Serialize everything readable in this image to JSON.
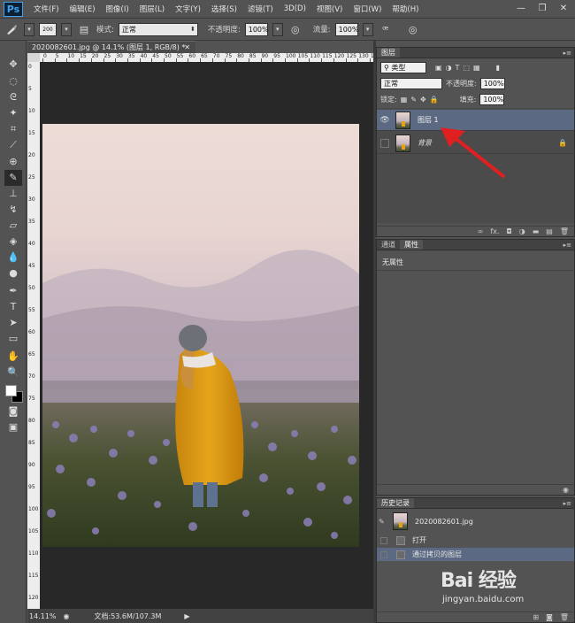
{
  "app": {
    "logo": "Ps"
  },
  "menu": [
    "文件(F)",
    "编辑(E)",
    "图像(I)",
    "图层(L)",
    "文字(Y)",
    "选择(S)",
    "滤镜(T)",
    "3D(D)",
    "视图(V)",
    "窗口(W)",
    "帮助(H)"
  ],
  "window_controls": {
    "minimize": "—",
    "restore": "❐",
    "close": "✕"
  },
  "options": {
    "brush_size": "200",
    "mode_label": "模式:",
    "mode_value": "正常",
    "opacity_label": "不透明度:",
    "opacity_value": "100%",
    "flow_label": "流量:",
    "flow_value": "100%"
  },
  "document": {
    "tab_title": "2020082601.jpg @ 14.1% (图层 1, RGB/8) *",
    "ruler_h": [
      "0",
      "5",
      "10",
      "15",
      "20",
      "25",
      "30",
      "35",
      "40",
      "45",
      "50",
      "55",
      "60",
      "65",
      "70",
      "75",
      "80",
      "85",
      "90",
      "95",
      "100",
      "105",
      "110",
      "115",
      "120",
      "125",
      "130",
      "135"
    ],
    "ruler_v": [
      "0",
      "5",
      "10",
      "15",
      "20",
      "25",
      "30",
      "35",
      "40",
      "45",
      "50",
      "55",
      "60",
      "65",
      "70",
      "75",
      "80",
      "85",
      "90",
      "95",
      "100",
      "105",
      "110",
      "115",
      "120"
    ]
  },
  "status": {
    "zoom": "14.11%",
    "doc_info": "文档:53.6M/107.3M"
  },
  "layers_panel": {
    "tab": "图层",
    "filter_label": "类型",
    "blend_mode": "正常",
    "opacity_label": "不透明度:",
    "opacity_value": "100%",
    "lock_label": "锁定:",
    "fill_label": "填充:",
    "fill_value": "100%",
    "layers": [
      {
        "name": "图层 1",
        "selected": true,
        "visible": true
      },
      {
        "name": "背景",
        "selected": false,
        "visible": false,
        "locked": true
      }
    ],
    "footer": [
      "∞",
      "fx.",
      "◘",
      "◑",
      "▬",
      "▤",
      "🗑"
    ]
  },
  "properties_panel": {
    "tabs": [
      "通道",
      "属性"
    ],
    "active_tab": "属性",
    "content": "无属性"
  },
  "history_panel": {
    "tab": "历史记录",
    "snapshot": "2020082601.jpg",
    "items": [
      {
        "name": "打开",
        "selected": false
      },
      {
        "name": "通过拷贝的图层",
        "selected": true
      }
    ]
  },
  "watermark": {
    "logo": "Bai 经验",
    "url": "jingyan.baidu.com"
  },
  "colors": {
    "accent_selected": "#5b6a82",
    "arrow": "#e02020",
    "coat": "#e3a21a"
  }
}
